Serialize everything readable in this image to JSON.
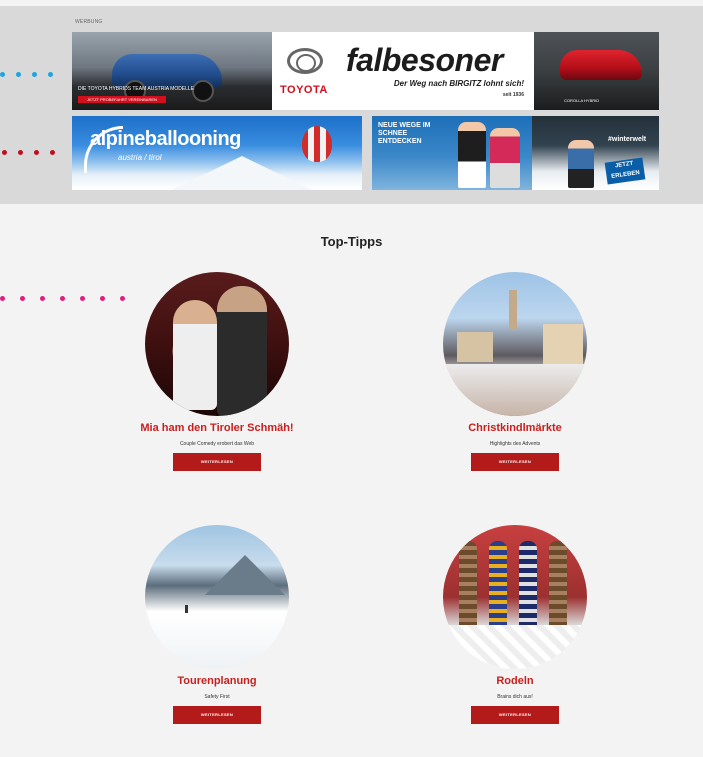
{
  "ad": {
    "label": "WERBUNG",
    "toyota_caption": "DIE TOYOTA HYBRIDS TEAM AUSTRIA MODELLE",
    "toyota_cta": "JETZT PROBEFAHRT VEREINBAREN",
    "toyota_brand": "TOYOTA",
    "dealer_name": "falbesoner",
    "dealer_slogan": "Der Weg nach BIRGITZ lohnt sich!",
    "dealer_since": "seit 1936",
    "car_right_caption": "COROLLA HYBRID",
    "alpine_name": "alpineballooning",
    "alpine_sub": "austria / tirol",
    "winter_text": "NEUE WEGE IM SCHNEE ENTDECKEN",
    "winter_brand": "#winterwelt",
    "winter_cta": "JETZT ERLEBEN"
  },
  "callouts": {
    "blue_color": "#1ea5e0",
    "red_color": "#c0101e",
    "pink_color": "#e01f7a"
  },
  "section": {
    "title": "Top-Tipps"
  },
  "tips": [
    {
      "title": "Mia ham den Tiroler Schmäh!",
      "subtitle": "Couple Comedy erobert das Web",
      "button": "WEITERLESEN",
      "image": "comedy-couple-photo"
    },
    {
      "title": "Christkindlmärkte",
      "subtitle": "Highlights des Advents",
      "button": "WEITERLESEN",
      "image": "christmas-market-photo"
    },
    {
      "title": "Tourenplanung",
      "subtitle": "Safety First",
      "button": "WEITERLESEN",
      "image": "ski-tour-photo"
    },
    {
      "title": "Rodeln",
      "subtitle": "Brains dich aus!",
      "button": "WEITERLESEN",
      "image": "sleds-photo"
    }
  ],
  "colors": {
    "accent": "#c8201f",
    "button": "#b31b1b"
  }
}
